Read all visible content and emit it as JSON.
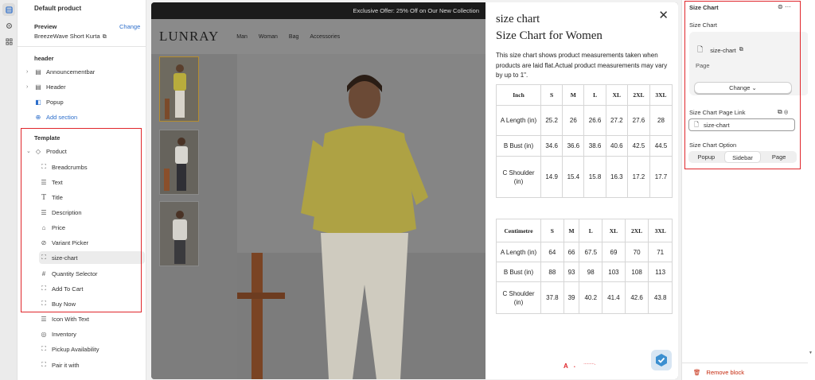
{
  "rail": {
    "icons": [
      "sections-icon",
      "settings-icon",
      "apps-icon"
    ]
  },
  "left_panel": {
    "title": "Default product",
    "preview_label": "Preview",
    "change_label": "Change",
    "preview_value": "BreezeWave Short Kurta",
    "header_section": "header",
    "header_items": [
      {
        "label": "Announcementbar",
        "icon": "layout-icon"
      },
      {
        "label": "Header",
        "icon": "layout-icon"
      },
      {
        "label": "Popup",
        "icon": "popup-icon"
      }
    ],
    "add_section": "Add section",
    "template_section": "Template",
    "product_label": "Product",
    "blocks": [
      {
        "label": "Breadcrumbs",
        "icon": "block-icon"
      },
      {
        "label": "Text",
        "icon": "text-icon"
      },
      {
        "label": "Title",
        "icon": "title-icon"
      },
      {
        "label": "Description",
        "icon": "text-icon"
      },
      {
        "label": "Price",
        "icon": "price-icon"
      },
      {
        "label": "Variant Picker",
        "icon": "variant-icon"
      },
      {
        "label": "size-chart",
        "icon": "block-icon"
      },
      {
        "label": "Quantity Selector",
        "icon": "hash-icon"
      },
      {
        "label": "Add To Cart",
        "icon": "block-icon"
      },
      {
        "label": "Buy Now",
        "icon": "block-icon"
      },
      {
        "label": "Icon With Text",
        "icon": "text-icon"
      },
      {
        "label": "Inventory",
        "icon": "inventory-icon"
      },
      {
        "label": "Pickup Availability",
        "icon": "block-icon"
      },
      {
        "label": "Pair it with",
        "icon": "block-icon"
      }
    ]
  },
  "storefront": {
    "announcement": "Exclusive Offer: 25% Off on Our New Collection",
    "logo": "LUNRAY",
    "nav": [
      "Man",
      "Woman",
      "Bag",
      "Accessories"
    ]
  },
  "size_chart_modal": {
    "heading": "size chart",
    "title": "Size Chart for Women",
    "description": "This size chart shows product measurements taken when products are laid flat.Actual product measurements may vary by up to 1\".",
    "inch_table": {
      "headers": [
        "Inch",
        "S",
        "M",
        "L",
        "XL",
        "2XL",
        "3XL"
      ],
      "rows": [
        [
          "A Length (in)",
          "25.2",
          "26",
          "26.6",
          "27.2",
          "27.6",
          "28"
        ],
        [
          "B Bust (in)",
          "34.6",
          "36.6",
          "38.6",
          "40.6",
          "42.5",
          "44.5"
        ],
        [
          "C Shoulder (in)",
          "14.9",
          "15.4",
          "15.8",
          "16.3",
          "17.2",
          "17.7"
        ]
      ]
    },
    "cm_table": {
      "headers": [
        "Centimetre",
        "S",
        "M",
        "L",
        "XL",
        "2XL",
        "3XL"
      ],
      "rows": [
        [
          "A Length (in)",
          "64",
          "66",
          "67.5",
          "69",
          "70",
          "71"
        ],
        [
          "B Bust (in)",
          "88",
          "93",
          "98",
          "103",
          "108",
          "113"
        ],
        [
          "C Shoulder (in)",
          "37.8",
          "39",
          "40.2",
          "41.4",
          "42.6",
          "43.8"
        ]
      ]
    },
    "footer_mark": "A"
  },
  "right_panel": {
    "title": "Size Chart",
    "size_chart_label": "Size Chart",
    "file_name": "size-chart",
    "file_type": "Page",
    "change_button": "Change",
    "page_link_label": "Size Chart Page Link",
    "page_link_value": "size-chart",
    "option_label": "Size Chart Option",
    "options": [
      "Popup",
      "Sidebar",
      "Page"
    ],
    "selected_option": "Sidebar",
    "remove_block": "Remove block"
  },
  "colors": {
    "accent": "#2c6ecb",
    "highlight": "#e0262b",
    "danger": "#c5280c"
  }
}
